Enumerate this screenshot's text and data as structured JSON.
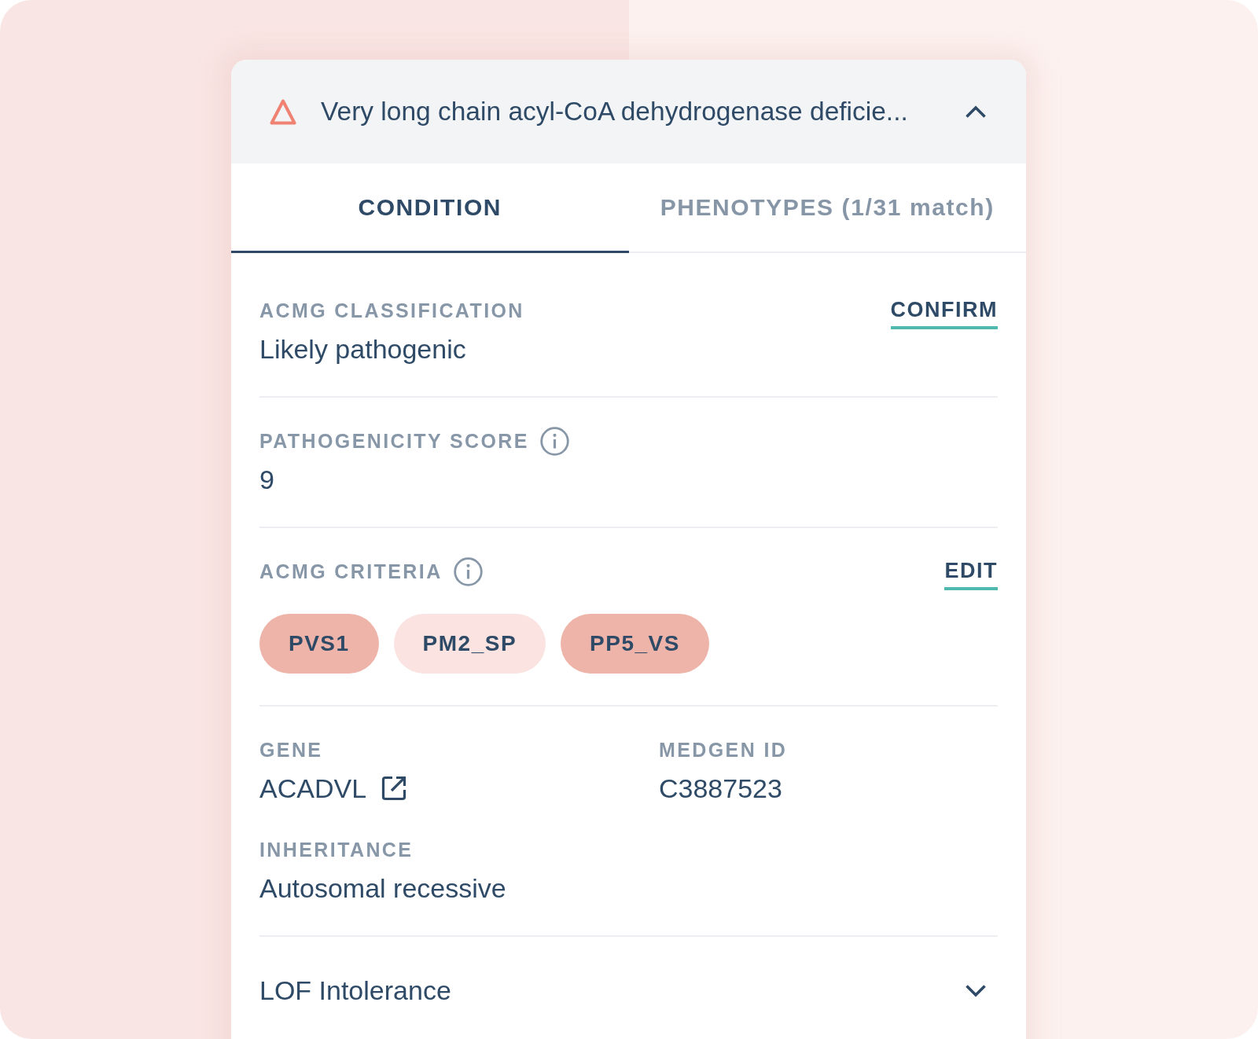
{
  "header": {
    "title": "Very long chain acyl-CoA dehydrogenase deficie...",
    "expanded": true
  },
  "tabs": [
    {
      "label": "CONDITION",
      "selected": true
    },
    {
      "label": "PHENOTYPES (1/31 match)",
      "selected": false
    }
  ],
  "sections": [
    {
      "kind": "field",
      "label": "ACMG CLASSIFICATION",
      "info": false,
      "action": "CONFIRM",
      "value": "Likely pathogenic"
    },
    {
      "kind": "field",
      "label": "PATHOGENICITY SCORE",
      "info": true,
      "value": "9"
    },
    {
      "kind": "criteria",
      "label": "ACMG CRITERIA",
      "info": true,
      "action": "EDIT",
      "chips": [
        {
          "label": "PVS1",
          "color": "#efb4a9"
        },
        {
          "label": "PM2_SP",
          "color": "#fae3e0"
        },
        {
          "label": "PP5_VS",
          "color": "#efb4a9"
        }
      ]
    },
    {
      "kind": "details",
      "fields": [
        {
          "label": "GENE",
          "value": "ACADVL",
          "link": true
        },
        {
          "label": "MEDGEN ID",
          "value": "C3887523",
          "link": false
        },
        {
          "label": "INHERITANCE",
          "value": "Autosomal recessive",
          "link": false
        }
      ]
    },
    {
      "kind": "collapsible",
      "title": "LOF Intolerance",
      "expanded": false
    }
  ]
}
